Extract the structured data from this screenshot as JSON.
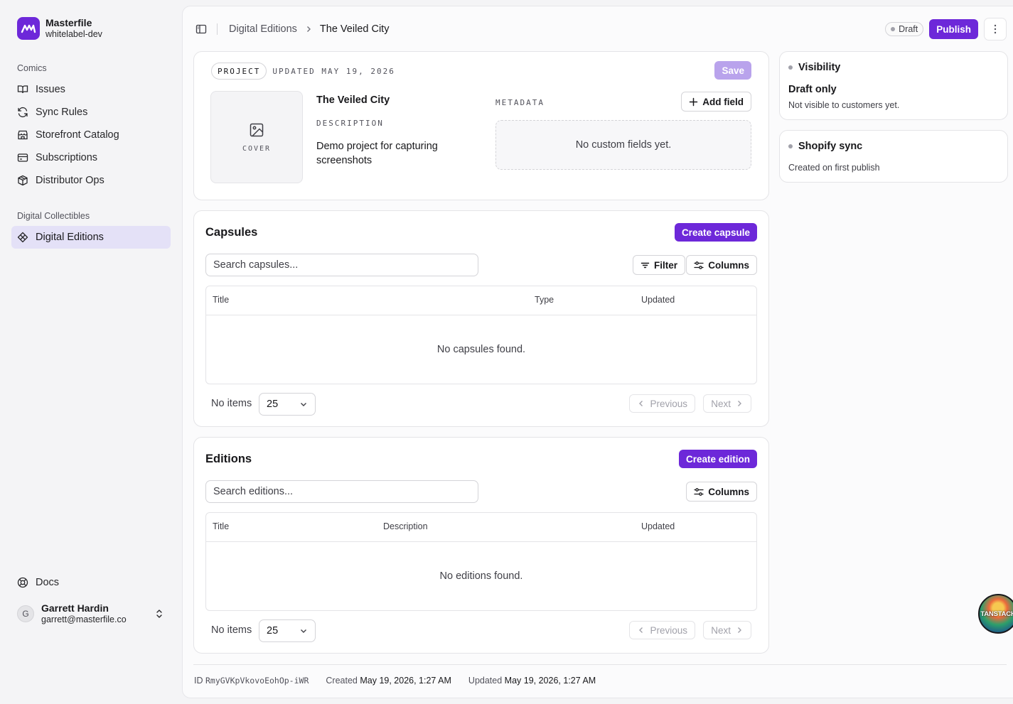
{
  "sidebar": {
    "brand_name": "Masterfile",
    "brand_org": "whitelabel-dev",
    "groups": [
      {
        "title": "Comics",
        "items": [
          {
            "label": "Issues",
            "icon": "book-open-icon"
          },
          {
            "label": "Sync Rules",
            "icon": "refresh-icon"
          },
          {
            "label": "Storefront Catalog",
            "icon": "store-icon"
          },
          {
            "label": "Subscriptions",
            "icon": "credit-card-icon"
          },
          {
            "label": "Distributor Ops",
            "icon": "package-icon"
          }
        ]
      },
      {
        "title": "Digital Collectibles",
        "items": [
          {
            "label": "Digital Editions",
            "icon": "diamond-icon",
            "active": true
          }
        ]
      }
    ],
    "docs_label": "Docs",
    "user": {
      "initial": "G",
      "name": "Garrett Hardin",
      "email": "garrett@masterfile.co"
    }
  },
  "topbar": {
    "breadcrumbs": [
      "Digital Editions",
      "The Veiled City"
    ],
    "status_badge": "Draft",
    "publish_label": "Publish"
  },
  "project": {
    "tag": "PROJECT",
    "updated": "UPDATED MAY 19, 2026",
    "save_label": "Save",
    "cover_label": "COVER",
    "title": "The Veiled City",
    "description_heading": "DESCRIPTION",
    "description": "Demo project for capturing screenshots",
    "metadata_heading": "METADATA",
    "add_field_label": "Add field",
    "no_fields": "No custom fields yet."
  },
  "capsules": {
    "title": "Capsules",
    "create_label": "Create capsule",
    "search_placeholder": "Search capsules...",
    "filter_label": "Filter",
    "columns_label": "Columns",
    "headers": [
      "Title",
      "Type",
      "Updated"
    ],
    "empty": "No capsules found.",
    "no_items": "No items",
    "page_size": "25",
    "previous": "Previous",
    "next": "Next"
  },
  "editions": {
    "title": "Editions",
    "create_label": "Create edition",
    "search_placeholder": "Search editions...",
    "columns_label": "Columns",
    "headers": [
      "Title",
      "Description",
      "Updated"
    ],
    "empty": "No editions found.",
    "no_items": "No items",
    "page_size": "25",
    "previous": "Previous",
    "next": "Next"
  },
  "visibility": {
    "title": "Visibility",
    "state": "Draft only",
    "note": "Not visible to customers yet."
  },
  "shopify": {
    "title": "Shopify sync",
    "note": "Created on first publish"
  },
  "footer": {
    "id_label": "ID",
    "id_value": "RmyGVKpVkovoEohOp-iWR",
    "created_label": "Created",
    "created_value": "May 19, 2026, 1:27 AM",
    "updated_label": "Updated",
    "updated_value": "May 19, 2026, 1:27 AM"
  },
  "devtools_badge": "TANSTACK",
  "colors": {
    "accent": "#6d28d9",
    "accent_disabled": "#b9a3ec",
    "active_nav": "#e4e1f7"
  }
}
